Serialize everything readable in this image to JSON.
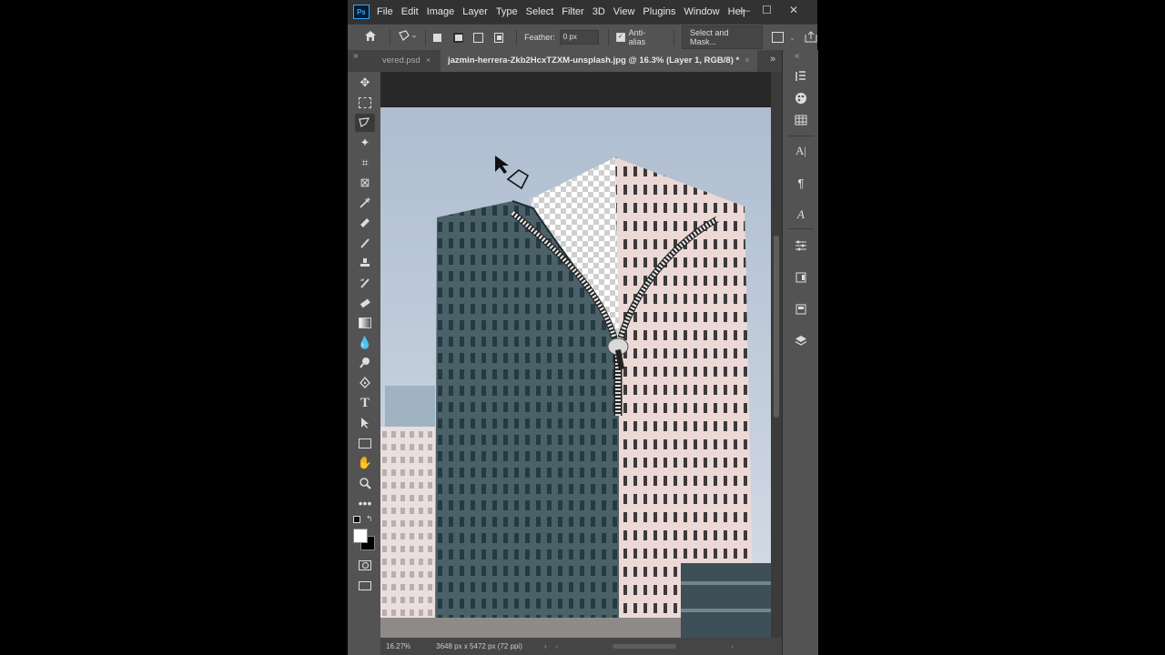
{
  "app": {
    "logo": "Ps"
  },
  "menu": [
    "File",
    "Edit",
    "Image",
    "Layer",
    "Type",
    "Select",
    "Filter",
    "3D",
    "View",
    "Plugins",
    "Window",
    "Help"
  ],
  "window_controls": {
    "minimize": "—",
    "restore": "☐",
    "close": "✕"
  },
  "options": {
    "feather_label": "Feather:",
    "feather_value": "0 px",
    "antialias_label": "Anti-alias",
    "select_mask_label": "Select and Mask..."
  },
  "tabs": [
    {
      "label": "vered.psd",
      "close": "×"
    },
    {
      "label": "jazmin-herrera-Zkb2HcxTZXM-unsplash.jpg @ 16.3% (Layer 1, RGB/8) *",
      "close": "×"
    }
  ],
  "status": {
    "zoom": "16.27%",
    "doc_info": "3648 px x 5472 px (72 ppi)"
  },
  "icons": {
    "toolbar": [
      "move-icon",
      "marquee-icon",
      "polygonal-lasso-icon",
      "magic-wand-icon",
      "crop-icon",
      "frame-icon",
      "eyedropper-icon",
      "healing-brush-icon",
      "brush-icon",
      "clone-stamp-icon",
      "history-brush-icon",
      "eraser-icon",
      "gradient-icon",
      "blur-icon",
      "dodge-icon",
      "pen-icon",
      "type-icon",
      "path-selection-icon",
      "rectangle-icon",
      "hand-icon",
      "zoom-icon",
      "more-tools-icon"
    ],
    "panel": [
      "history-icon",
      "color-icon",
      "swatches-icon",
      "character-icon",
      "paragraph-icon",
      "glyphs-icon",
      "adjustments-icon",
      "libraries-icon",
      "properties-icon",
      "layers-icon"
    ]
  },
  "colors": {
    "accent": "#31a8ff",
    "ui_bg": "#535353",
    "menubar": "#323232",
    "canvas_bg": "#282828"
  }
}
